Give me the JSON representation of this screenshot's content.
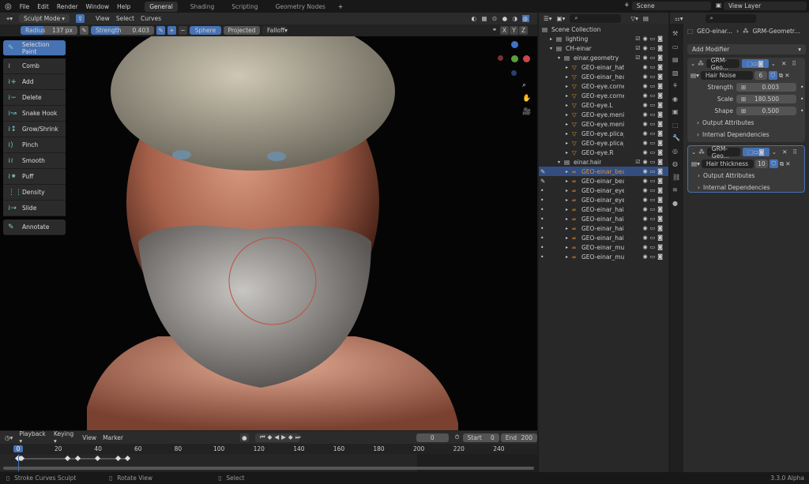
{
  "menu": [
    "File",
    "Edit",
    "Render",
    "Window",
    "Help"
  ],
  "workspaces": [
    "General",
    "Shading",
    "Scripting",
    "Geometry Nodes"
  ],
  "active_workspace": "General",
  "scene": {
    "label": "Scene",
    "view_layer": "View Layer"
  },
  "viewport_header": {
    "mode": "Sculpt Mode",
    "menus": [
      "View",
      "Select",
      "Curves"
    ]
  },
  "tool_settings": {
    "radius_label": "Radius",
    "radius_value": "137 px",
    "strength_label": "Strength",
    "strength_value": "0.403",
    "sphere": "Sphere",
    "projected": "Projected",
    "falloff": "Falloff",
    "axes": [
      "X",
      "Y",
      "Z"
    ]
  },
  "tools": [
    "Selection Paint",
    "Comb",
    "Add",
    "Delete",
    "Snake Hook",
    "Grow/Shrink",
    "Pinch",
    "Smooth",
    "Puff",
    "Density",
    "Slide",
    "Annotate"
  ],
  "gizmo": {
    "axes": [
      "X",
      "Y",
      "Z"
    ]
  },
  "outliner": {
    "rows": [
      {
        "label": "Scene Collection",
        "indent": 0,
        "type": "scene"
      },
      {
        "label": "lighting",
        "indent": 1,
        "type": "coll"
      },
      {
        "label": "CH-einar",
        "indent": 1,
        "type": "coll"
      },
      {
        "label": "einar.geometry",
        "indent": 2,
        "type": "coll"
      },
      {
        "label": "GEO-einar_hat",
        "indent": 3,
        "type": "mesh"
      },
      {
        "label": "GEO-einar_head",
        "indent": 3,
        "type": "mesh"
      },
      {
        "label": "GEO-eye.cornea",
        "indent": 3,
        "type": "mesh"
      },
      {
        "label": "GEO-eye.cornea",
        "indent": 3,
        "type": "mesh"
      },
      {
        "label": "GEO-eye.L",
        "indent": 3,
        "type": "mesh"
      },
      {
        "label": "GEO-eye.menisc",
        "indent": 3,
        "type": "mesh"
      },
      {
        "label": "GEO-eye.menisc",
        "indent": 3,
        "type": "mesh"
      },
      {
        "label": "GEO-eye.plica_s",
        "indent": 3,
        "type": "mesh"
      },
      {
        "label": "GEO-eye.plica_s",
        "indent": 3,
        "type": "mesh"
      },
      {
        "label": "GEO-eye.R",
        "indent": 3,
        "type": "mesh"
      },
      {
        "label": "einar.hair",
        "indent": 2,
        "type": "coll"
      },
      {
        "label": "GEO-einar_bear",
        "indent": 3,
        "type": "hair",
        "selected": true
      },
      {
        "label": "GEO-einar_bear",
        "indent": 3,
        "type": "hair"
      },
      {
        "label": "GEO-einar_eyeb",
        "indent": 3,
        "type": "hair"
      },
      {
        "label": "GEO-einar_eyel",
        "indent": 3,
        "type": "hair"
      },
      {
        "label": "GEO-einar_hair",
        "indent": 3,
        "type": "hair"
      },
      {
        "label": "GEO-einar_hair.",
        "indent": 3,
        "type": "hair"
      },
      {
        "label": "GEO-einar_hair_",
        "indent": 3,
        "type": "hair"
      },
      {
        "label": "GEO-einar_hair_",
        "indent": 3,
        "type": "hair"
      },
      {
        "label": "GEO-einar_must",
        "indent": 3,
        "type": "hair"
      },
      {
        "label": "GEO-einar_must",
        "indent": 3,
        "type": "hair"
      }
    ]
  },
  "properties": {
    "breadcrumb": [
      "GEO-einar...",
      "GRM-Geometr..."
    ],
    "add_modifier": "Add Modifier",
    "modifiers": [
      {
        "name": "GRM-Geo...",
        "node_group": "Hair Noise",
        "users": "6",
        "inputs": [
          {
            "label": "Strength",
            "value": "0.003"
          },
          {
            "label": "Scale",
            "value": "180.500"
          },
          {
            "label": "Shape",
            "value": "0.500"
          }
        ],
        "sections": [
          "Output Attributes",
          "Internal Dependencies"
        ]
      },
      {
        "name": "GRM-Geo...",
        "node_group": "Hair thickness",
        "users": "10",
        "inputs": [],
        "sections": [
          "Output Attributes",
          "Internal Dependencies"
        ]
      }
    ]
  },
  "timeline": {
    "menus": [
      "Playback",
      "Keying",
      "View",
      "Marker"
    ],
    "current_frame": "0",
    "start_label": "Start",
    "start": "0",
    "end_label": "End",
    "end": "200",
    "ticks": [
      "0",
      "20",
      "40",
      "60",
      "80",
      "100",
      "120",
      "140",
      "160",
      "180",
      "200",
      "220",
      "240"
    ],
    "keyframes": [
      0,
      1,
      2,
      25,
      30,
      40,
      50,
      55
    ]
  },
  "status": {
    "items": [
      "Stroke Curves Sculpt",
      "Rotate View",
      "Select"
    ],
    "version": "3.3.0 Alpha"
  },
  "colors": {
    "accent": "#4772b3",
    "selection": "#334d80",
    "hair_icon": "#e0902a"
  }
}
